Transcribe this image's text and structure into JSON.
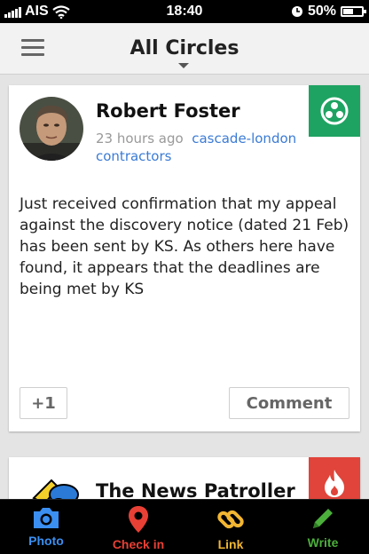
{
  "status_bar": {
    "carrier": "AIS",
    "time": "18:40",
    "battery_percent": "50%",
    "battery_level": 0.5,
    "icons": [
      "signal-icon",
      "wifi-icon",
      "clock-icon",
      "battery-icon"
    ]
  },
  "header": {
    "title": "All Circles",
    "menu_icon": "hamburger-icon",
    "dropdown_icon": "caret-down-icon"
  },
  "posts": [
    {
      "author": "Robert Foster",
      "time_ago": "23 hours ago",
      "community": "cascade-london contractors",
      "badge_icon": "community-icon",
      "badge_color": "#1ea362",
      "text": "Just received confirmation that my appeal against the discovery notice (dated 21 Feb) has been sent by KS. As others here have found, it appears that the deadlines are being met by KS",
      "plus_one_label": "+1",
      "comment_label": "Comment"
    },
    {
      "author": "The News Patroller",
      "badge_icon": "flame-icon",
      "badge_color": "#e0443a"
    }
  ],
  "tabs": [
    {
      "label": "Photo",
      "icon": "camera-icon",
      "color": "#3b8ff0"
    },
    {
      "label": "Check in",
      "icon": "map-pin-icon",
      "color": "#e84035"
    },
    {
      "label": "Link",
      "icon": "link-icon",
      "color": "#f2b632"
    },
    {
      "label": "Write",
      "icon": "pencil-icon",
      "color": "#4caf3c"
    }
  ]
}
